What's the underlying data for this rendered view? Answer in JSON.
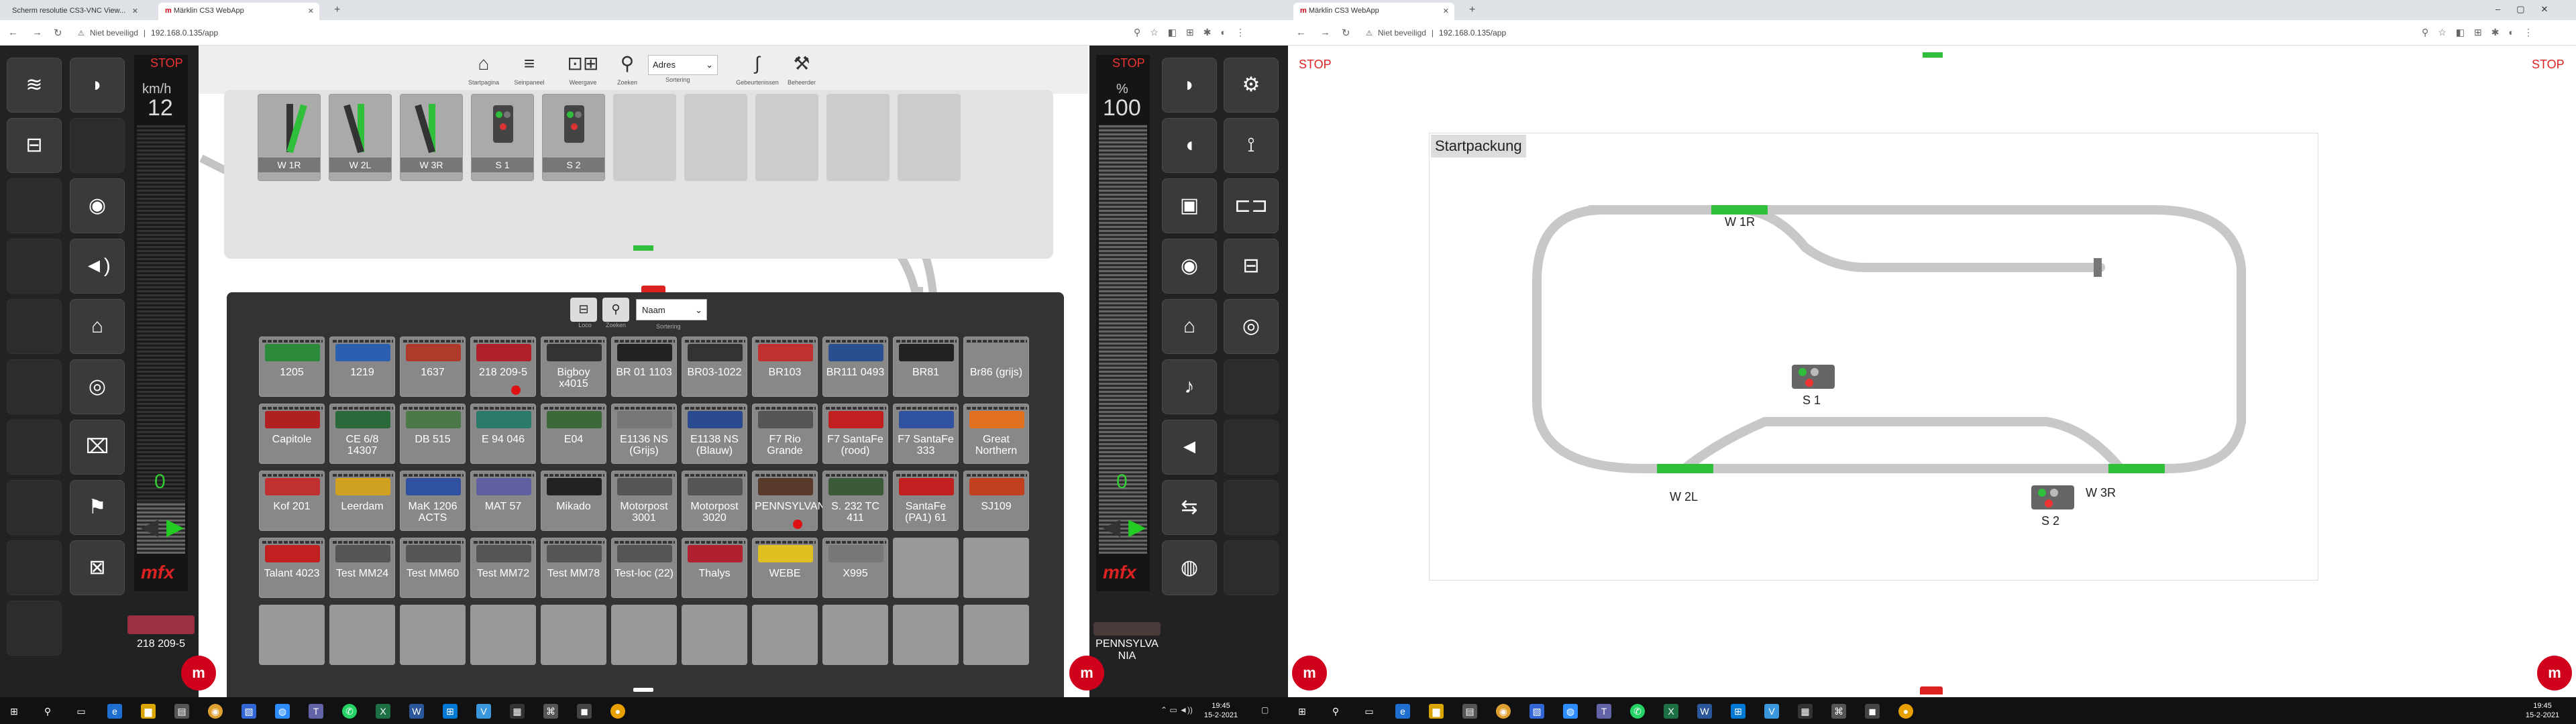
{
  "left_browser": {
    "tabs": [
      {
        "label": "Scherm resolutie CS3-VNC View...",
        "active": false
      },
      {
        "label": "Märklin CS3 WebApp",
        "active": true
      }
    ],
    "security": "Niet beveiligd",
    "url": "192.168.0.135/app"
  },
  "right_browser": {
    "tabs": [
      {
        "label": "Märklin CS3 WebApp",
        "active": true
      }
    ],
    "security": "Niet beveiligd",
    "url": "192.168.0.135/app"
  },
  "cs3_left": {
    "left_loco": {
      "stop": "STOP",
      "unit": "km/h",
      "speed": "12",
      "speed_zero": "0",
      "fraction": 0.12,
      "decoder": "mfx",
      "name": "218 209-5"
    },
    "right_loco": {
      "stop": "STOP",
      "unit": "%",
      "speed": "100",
      "speed_zero": "0",
      "fraction": 1.0,
      "decoder": "mfx",
      "name": "PENNSYLVANIA"
    },
    "toolbar": {
      "items": [
        {
          "icon": "home-icon",
          "label": "Startpagina"
        },
        {
          "icon": "stacked-tracks-icon",
          "label": "Seinpaneel"
        },
        {
          "icon": "view-icon",
          "label": "Weergave"
        },
        {
          "icon": "search-icon",
          "label": "Zoeken"
        },
        {
          "icon": "curve-icon",
          "label": "Gebeurtenissen"
        },
        {
          "icon": "wrench-icon",
          "label": "Beheerder"
        }
      ],
      "sort_value": "Adres",
      "sort_label": "Sortering"
    },
    "accessories": [
      {
        "label": "W 1R",
        "kind": "switch"
      },
      {
        "label": "W 2L",
        "kind": "switch"
      },
      {
        "label": "W 3R",
        "kind": "switch"
      },
      {
        "label": "S 1",
        "kind": "signal"
      },
      {
        "label": "S 2",
        "kind": "signal"
      }
    ],
    "loco_list": {
      "sort_value": "Naam",
      "sort_label": "Sortering",
      "btn1_label": "Loco",
      "btn2_label": "Zoeken",
      "locos": [
        {
          "name": "1205",
          "color": "#2a8a3a",
          "dot": false
        },
        {
          "name": "1219",
          "color": "#2a5fb0",
          "dot": false
        },
        {
          "name": "1637",
          "color": "#b03a2a",
          "dot": false
        },
        {
          "name": "218 209-5",
          "color": "#b0202a",
          "dot": true
        },
        {
          "name": "Bigboy x4015",
          "color": "#333333",
          "dot": false
        },
        {
          "name": "BR 01 1103",
          "color": "#222222",
          "dot": false
        },
        {
          "name": "BR03-1022",
          "color": "#333333",
          "dot": false
        },
        {
          "name": "BR103",
          "color": "#c03030",
          "dot": false
        },
        {
          "name": "BR111 0493",
          "color": "#2a4f90",
          "dot": false
        },
        {
          "name": "BR81",
          "color": "#222222",
          "dot": false
        },
        {
          "name": "Br86 (grijs)",
          "color": "#888888",
          "dot": false
        },
        {
          "name": "Capitole",
          "color": "#b02020",
          "dot": false
        },
        {
          "name": "CE 6/8 14307",
          "color": "#2a6a3a",
          "dot": false
        },
        {
          "name": "DB 515",
          "color": "#4a7a4a",
          "dot": false
        },
        {
          "name": "E 94 046",
          "color": "#2a7a6a",
          "dot": false
        },
        {
          "name": "E04",
          "color": "#3a6a3a",
          "dot": false
        },
        {
          "name": "E1136 NS (Grijs)",
          "color": "#777777",
          "dot": false
        },
        {
          "name": "E1138 NS (Blauw)",
          "color": "#2a4a90",
          "dot": false
        },
        {
          "name": "F7 Rio Grande",
          "color": "#555555",
          "dot": false
        },
        {
          "name": "F7 SantaFe (rood)",
          "color": "#c02020",
          "dot": false
        },
        {
          "name": "F7 SantaFe 333",
          "color": "#3050a0",
          "dot": false
        },
        {
          "name": "Great Northern",
          "color": "#e07020",
          "dot": false
        },
        {
          "name": "Kof 201",
          "color": "#c03030",
          "dot": false
        },
        {
          "name": "Leerdam",
          "color": "#d0a020",
          "dot": false
        },
        {
          "name": "MaK 1206 ACTS",
          "color": "#3050a0",
          "dot": false
        },
        {
          "name": "MAT 57",
          "color": "#6060a0",
          "dot": false
        },
        {
          "name": "Mikado",
          "color": "#222222",
          "dot": false
        },
        {
          "name": "Motorpost 3001",
          "color": "#555555",
          "dot": false
        },
        {
          "name": "Motorpost 3020",
          "color": "#555555",
          "dot": false
        },
        {
          "name": "PENNSYLVANIA",
          "color": "#5a3a2a",
          "dot": true
        },
        {
          "name": "S. 232 TC 411",
          "color": "#3a5a3a",
          "dot": false
        },
        {
          "name": "SantaFe (PA1) 61",
          "color": "#c02020",
          "dot": false
        },
        {
          "name": "SJ109",
          "color": "#c04020",
          "dot": false
        },
        {
          "name": "Talant 4023",
          "color": "#c02020",
          "dot": false
        },
        {
          "name": "Test MM24",
          "color": "#555555",
          "dot": false
        },
        {
          "name": "Test MM60",
          "color": "#555555",
          "dot": false
        },
        {
          "name": "Test MM72",
          "color": "#555555",
          "dot": false
        },
        {
          "name": "Test MM78",
          "color": "#555555",
          "dot": false
        },
        {
          "name": "Test-loc (22)",
          "color": "#555555",
          "dot": false
        },
        {
          "name": "Thalys",
          "color": "#b02030",
          "dot": false
        },
        {
          "name": "WEBE",
          "color": "#e0c020",
          "dot": false
        },
        {
          "name": "X995",
          "color": "#777777",
          "dot": false
        }
      ]
    }
  },
  "cs3_right": {
    "stop_left": "STOP",
    "stop_right": "STOP",
    "layout_title": "Startpackung",
    "labels": {
      "w1r": "W 1R",
      "w2l": "W 2L",
      "w3r": "W 3R",
      "s1": "S 1",
      "s2": "S 2"
    }
  },
  "taskbar_left": {
    "time": "19:45",
    "date": "15-2-2021"
  },
  "taskbar_right": {
    "time": "19:45",
    "date": "15-2-2021"
  },
  "colors": {
    "accent": "#d0021b",
    "track": "#c8c8c8",
    "switch_on": "#2fbf3a",
    "panel": "#222222"
  }
}
